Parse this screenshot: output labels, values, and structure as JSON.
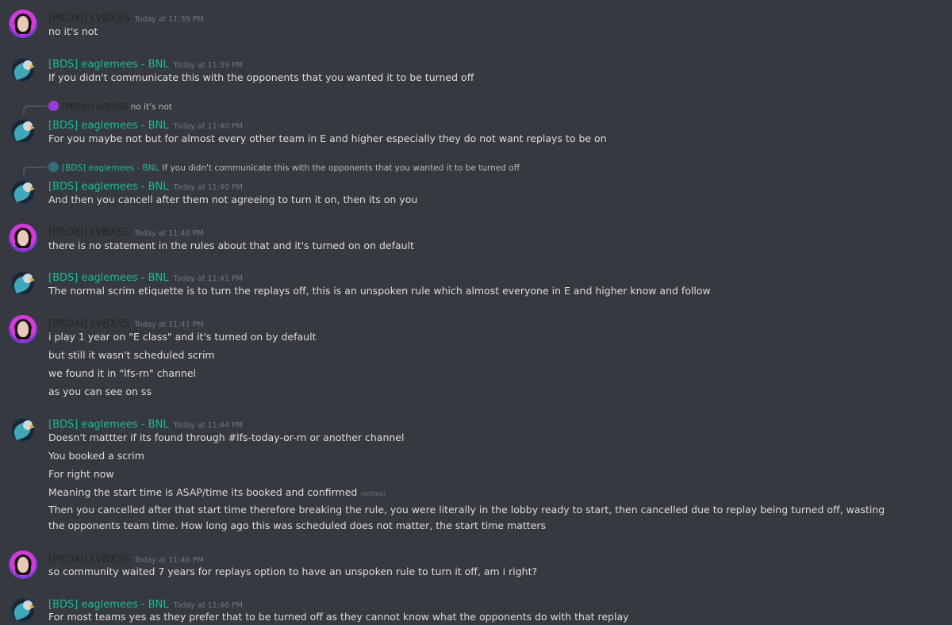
{
  "users": {
    "proxi": "[PROXI] LVBXSS",
    "eagle": "[BDS] eaglemees - BNL"
  },
  "messages": [
    {
      "author": "[PROXI] LVBXSS",
      "time": "Today at 11:39 PM",
      "lines": [
        "no it's not"
      ]
    },
    {
      "author": "[BDS] eaglemees - BNL",
      "time": "Today at 11:39 PM",
      "lines": [
        "If you didn't communicate this with the opponents that you wanted it to be turned off"
      ]
    },
    {
      "reply_author": "[PROXI] LVBXSS",
      "reply_text": "no it's not",
      "author": "[BDS] eaglemees - BNL",
      "time": "Today at 11:40 PM",
      "lines": [
        "For you maybe not but for almost every other team in E and higher especially they do not want replays to be on"
      ]
    },
    {
      "reply_author": "[BDS] eaglemees - BNL",
      "reply_text": "If you didn't communicate this with the opponents that you wanted it to be turned off",
      "author": "[BDS] eaglemees - BNL",
      "time": "Today at 11:40 PM",
      "lines": [
        "And then you cancell after them not agreeing to turn it on, then its on you"
      ]
    },
    {
      "author": "[PROXI] LVBXSS",
      "time": "Today at 11:40 PM",
      "lines": [
        "there is no statement in the rules about that and it's turned on on default"
      ]
    },
    {
      "author": "[BDS] eaglemees - BNL",
      "time": "Today at 11:41 PM",
      "lines": [
        "The normal scrim etiquette is to turn the replays off, this is an unspoken rule which almost everyone in E and higher know and follow"
      ]
    },
    {
      "author": "[PROXI] LVBXSS",
      "time": "Today at 11:41 PM",
      "lines": [
        "i play 1 year on \"E class\" and it's turned on by default",
        "but still it wasn't scheduled scrim",
        "we found it in \"lfs-rn\" channel",
        "as you can see on ss"
      ]
    },
    {
      "author": "[BDS] eaglemees - BNL",
      "time": "Today at 11:44 PM",
      "lines": [
        "Doesn't mattter if its found through #lfs-today-or-rn or another channel",
        "You booked a scrim",
        "For right now",
        "Meaning the start time is ASAP/time its booked and confirmed",
        "Then you cancelled after that start time therefore breaking the rule, you were literally in the lobby ready to start, then cancelled due to replay being turned off, wasting the opponents team time. How long ago this was scheduled does not matter, the start time matters"
      ],
      "edited": "(edited)"
    },
    {
      "author": "[PROXI] LVBXSS",
      "time": "Today at 11:46 PM",
      "lines": [
        "so community waited 7 years for replays option to have an unspoken rule to turn it off, am i right?"
      ]
    },
    {
      "author": "[BDS] eaglemees - BNL",
      "time": "Today at 11:46 PM",
      "lines": [
        "For most teams yes as they prefer that to be turned off as they cannot know what the opponents do with that replay"
      ]
    }
  ],
  "colors": {
    "background": "#36393f",
    "eagle_name": "#1abc9c",
    "proxi_name": "#23272a",
    "timestamp": "#72767d",
    "text": "#dcddde"
  }
}
